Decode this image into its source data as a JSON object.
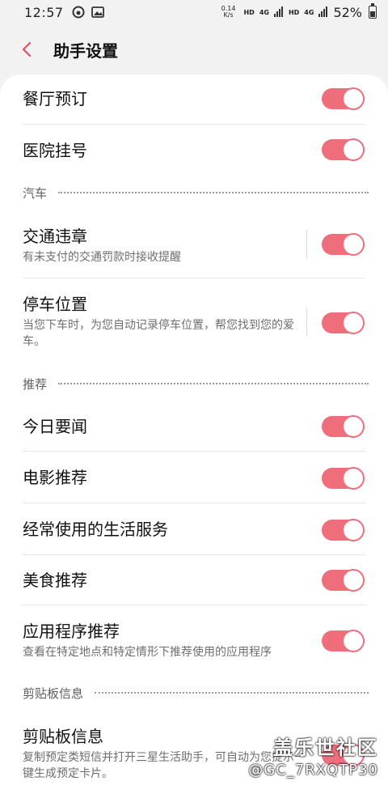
{
  "status_bar": {
    "time": "12:57",
    "net_speed_value": "0.14",
    "net_speed_unit": "K/s",
    "hd1": "HD",
    "lte1": "4G",
    "hd2": "HD",
    "lte2": "4G",
    "battery": "52%",
    "battery_level": 0.52
  },
  "header": {
    "title": "助手设置"
  },
  "rows": {
    "restaurant": {
      "label": "餐厅预订",
      "on": true
    },
    "hospital": {
      "label": "医院挂号",
      "on": true
    },
    "traffic": {
      "label": "交通违章",
      "desc": "有未支付的交通罚款时接收提醒",
      "on": true
    },
    "parking": {
      "label": "停车位置",
      "desc": "当您下车时，为您自动记录停车位置，帮您找到您的爱车。",
      "on": true
    },
    "news": {
      "label": "今日要闻",
      "on": true
    },
    "movies": {
      "label": "电影推荐",
      "on": true
    },
    "life": {
      "label": "经常使用的生活服务",
      "on": true
    },
    "food": {
      "label": "美食推荐",
      "on": true
    },
    "apps": {
      "label": "应用程序推荐",
      "desc": "查看在特定地点和特定情形下推荐使用的应用程序",
      "on": true
    },
    "clipboard": {
      "label": "剪贴板信息",
      "desc": "复制预定类短信并打开三星生活助手，可自动为您提示一键生成预定卡片。",
      "on": true
    }
  },
  "sections": {
    "car": "汽车",
    "recommend": "推荐",
    "clipboard": "剪贴板信息"
  },
  "watermark": {
    "line1": "盖乐世社区",
    "line2": "@GC_7RXQTP30"
  },
  "colors": {
    "accent": "#ee6e7c",
    "background": "#f2f2f2",
    "card": "#ffffff"
  }
}
